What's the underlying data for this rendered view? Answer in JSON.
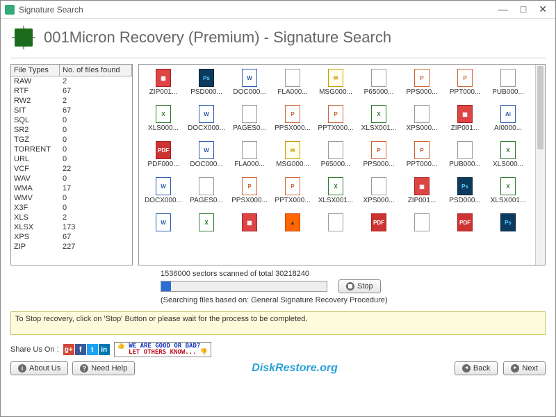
{
  "titlebar": {
    "title": "Signature Search"
  },
  "header": {
    "title": "001Micron Recovery (Premium) - Signature Search"
  },
  "table": {
    "columns": [
      "File Types",
      "No. of files found"
    ],
    "rows": [
      {
        "type": "RAW",
        "count": 2
      },
      {
        "type": "RTF",
        "count": 67
      },
      {
        "type": "RW2",
        "count": 2
      },
      {
        "type": "SIT",
        "count": 67
      },
      {
        "type": "SQL",
        "count": 0
      },
      {
        "type": "SR2",
        "count": 0
      },
      {
        "type": "TGZ",
        "count": 0
      },
      {
        "type": "TORRENT",
        "count": 0
      },
      {
        "type": "URL",
        "count": 0
      },
      {
        "type": "VCF",
        "count": 22
      },
      {
        "type": "WAV",
        "count": 0
      },
      {
        "type": "WMA",
        "count": 17
      },
      {
        "type": "WMV",
        "count": 0
      },
      {
        "type": "X3F",
        "count": 0
      },
      {
        "type": "XLS",
        "count": 2
      },
      {
        "type": "XLSX",
        "count": 173
      },
      {
        "type": "XPS",
        "count": 67
      },
      {
        "type": "ZIP",
        "count": 227
      }
    ]
  },
  "files": [
    {
      "label": "ZIP001...",
      "k": "zip",
      "g": "▦"
    },
    {
      "label": "PSD000...",
      "k": "ps",
      "g": "Ps"
    },
    {
      "label": "DOC000...",
      "k": "doc",
      "g": "W"
    },
    {
      "label": "FLA000...",
      "k": "blank",
      "g": ""
    },
    {
      "label": "MSG000...",
      "k": "msg",
      "g": "✉"
    },
    {
      "label": "P65000...",
      "k": "blank",
      "g": ""
    },
    {
      "label": "PPS000...",
      "k": "ppt",
      "g": "P"
    },
    {
      "label": "PPT000...",
      "k": "ppt",
      "g": "P"
    },
    {
      "label": "PUB000...",
      "k": "blank",
      "g": ""
    },
    {
      "label": "XLS000...",
      "k": "xls",
      "g": "X"
    },
    {
      "label": "DOCX000...",
      "k": "doc",
      "g": "W"
    },
    {
      "label": "PAGES0...",
      "k": "blank",
      "g": ""
    },
    {
      "label": "PPSX000...",
      "k": "ppt",
      "g": "P"
    },
    {
      "label": "PPTX000...",
      "k": "ppt",
      "g": "P"
    },
    {
      "label": "XLSX001...",
      "k": "xls",
      "g": "X"
    },
    {
      "label": "XPS000...",
      "k": "blank",
      "g": ""
    },
    {
      "label": "ZIP001...",
      "k": "zip",
      "g": "▦"
    },
    {
      "label": "AI0000...",
      "k": "doc",
      "g": "Ai"
    },
    {
      "label": "PDF000...",
      "k": "pdf",
      "g": "PDF"
    },
    {
      "label": "DOC000...",
      "k": "doc",
      "g": "W"
    },
    {
      "label": "FLA000...",
      "k": "blank",
      "g": ""
    },
    {
      "label": "MSG000...",
      "k": "msg",
      "g": "✉"
    },
    {
      "label": "P65000...",
      "k": "blank",
      "g": ""
    },
    {
      "label": "PPS000...",
      "k": "ppt",
      "g": "P"
    },
    {
      "label": "PPT000...",
      "k": "ppt",
      "g": "P"
    },
    {
      "label": "PUB000...",
      "k": "blank",
      "g": ""
    },
    {
      "label": "XLS000...",
      "k": "xls",
      "g": "X"
    },
    {
      "label": "DOCX000...",
      "k": "doc",
      "g": "W"
    },
    {
      "label": "PAGES0...",
      "k": "blank",
      "g": ""
    },
    {
      "label": "PPSX000...",
      "k": "ppt",
      "g": "P"
    },
    {
      "label": "PPTX000...",
      "k": "ppt",
      "g": "P"
    },
    {
      "label": "XLSX001...",
      "k": "xls",
      "g": "X"
    },
    {
      "label": "XPS000...",
      "k": "blank",
      "g": ""
    },
    {
      "label": "ZIP001...",
      "k": "zip",
      "g": "▦"
    },
    {
      "label": "PSD000...",
      "k": "ps",
      "g": "Ps"
    },
    {
      "label": "XLSX001...",
      "k": "xls",
      "g": "X"
    },
    {
      "label": "",
      "k": "doc",
      "g": "W"
    },
    {
      "label": "",
      "k": "xls",
      "g": "X"
    },
    {
      "label": "",
      "k": "zip",
      "g": "▦"
    },
    {
      "label": "",
      "k": "vlc",
      "g": "▲"
    },
    {
      "label": "",
      "k": "blank",
      "g": ""
    },
    {
      "label": "",
      "k": "pdf",
      "g": "PDF"
    },
    {
      "label": "",
      "k": "blank",
      "g": ""
    },
    {
      "label": "",
      "k": "pdf",
      "g": "PDF"
    },
    {
      "label": "",
      "k": "ps",
      "g": "Ps"
    }
  ],
  "progress": {
    "text": "1536000 sectors scanned of total 30218240",
    "searching": "(Searching files based on:  General Signature Recovery Procedure)",
    "stop_label": "Stop"
  },
  "info": "To Stop recovery, click on 'Stop' Button or please wait for the process to be completed.",
  "share": {
    "label": "Share Us On :",
    "review1": "WE ARE GOOD OR BAD?",
    "review2": "LET OTHERS KNOW..."
  },
  "buttons": {
    "about": "About Us",
    "help": "Need Help",
    "back": "Back",
    "next": "Next"
  },
  "brand": "DiskRestore.org"
}
